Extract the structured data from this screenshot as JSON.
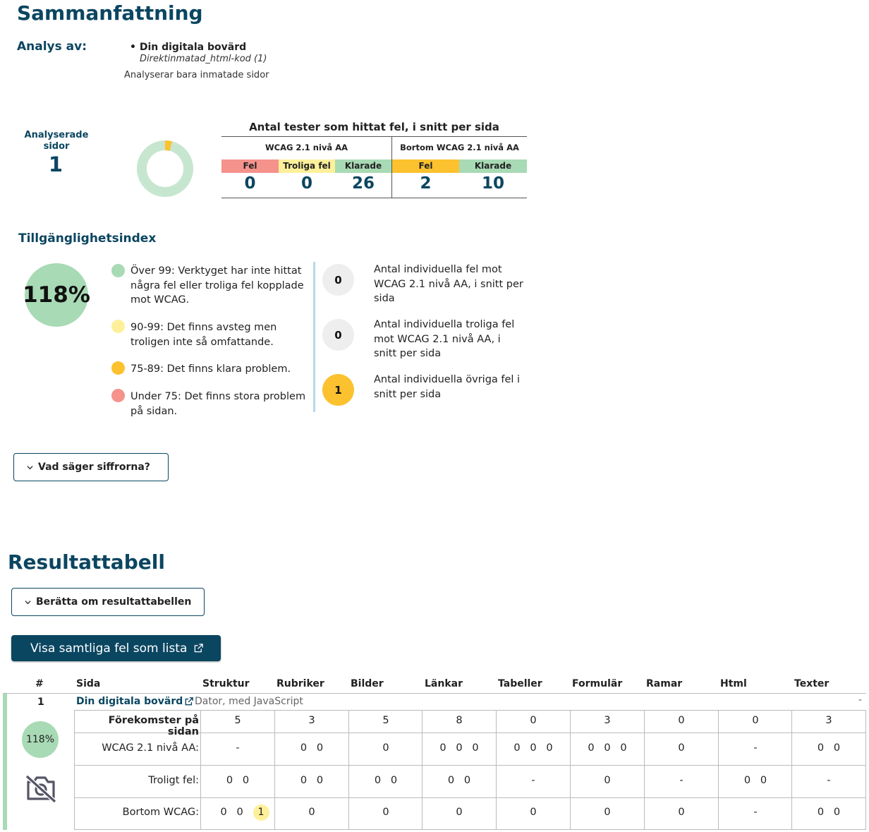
{
  "summary": {
    "title": "Sammanfattning",
    "analysis_label": "Analys av:",
    "site_name": "Din digitala bovärd",
    "site_source": "Direktinmatad_html-kod (1)",
    "scope_note": "Analyserar bara inmatade sidor",
    "analysed_pages_label_1": "Analyserade",
    "analysed_pages_label_2": "sidor",
    "analysed_pages_count": "1",
    "donut": {
      "passed_fraction": 0.96,
      "warn_fraction": 0.04,
      "passed_color": "#c7e6cf",
      "warn_color": "#fcc12e"
    }
  },
  "tests": {
    "title": "Antal tester som hittat fel, i snitt per sida",
    "wcag_group": "WCAG 2.1 nivå AA",
    "beyond_group": "Bortom WCAG 2.1 nivå AA",
    "wcag": {
      "fel_label": "Fel",
      "fel_value": "0",
      "troliga_label": "Troliga fel",
      "troliga_value": "0",
      "klarade_label": "Klarade",
      "klarade_value": "26"
    },
    "beyond": {
      "fel_label": "Fel",
      "fel_value": "2",
      "klarade_label": "Klarade",
      "klarade_value": "10"
    },
    "colors": {
      "fel": "#f5928c",
      "troliga": "#fdf09a",
      "klarade": "#a8dab5",
      "beyond_fel": "#fcc12e"
    }
  },
  "index": {
    "title": "Tillgänglighetsindex",
    "value": "118%",
    "legend": [
      {
        "text": "Över 99: Verktyget har inte hittat några fel eller troliga fel kopplade mot WCAG.",
        "color": "#a8dab5"
      },
      {
        "text": "90-99: Det finns avsteg men troligen inte så omfattande.",
        "color": "#fdf09a"
      },
      {
        "text": "75-89: Det finns klara problem.",
        "color": "#fcc12e"
      },
      {
        "text": "Under 75: Det finns stora problem på sidan.",
        "color": "#f5928c"
      }
    ],
    "counts": [
      {
        "value": "0",
        "text": "Antal individuella fel mot WCAG 2.1 nivå AA, i snitt per sida",
        "color": "#eeeeee"
      },
      {
        "value": "0",
        "text": "Antal individuella troliga fel mot WCAG 2.1 nivå AA, i snitt per sida",
        "color": "#eeeeee"
      },
      {
        "value": "1",
        "text": "Antal individuella övriga fel i snitt per sida",
        "color": "#fcc12e"
      }
    ],
    "expander_label": "Vad säger siffrorna?"
  },
  "results": {
    "title": "Resultattabell",
    "expander_label": "Berätta om resultattabellen",
    "show_all_label": "Visa samtliga fel som lista",
    "headers": [
      "#",
      "Sida",
      "Struktur",
      "Rubriker",
      "Bilder",
      "Länkar",
      "Tabeller",
      "Formulär",
      "Ramar",
      "Html",
      "Texter"
    ],
    "row": {
      "number": "1",
      "site": "Din digitala bovärd",
      "meta": "Dator, med JavaScript",
      "trailing": "-",
      "index": "118%",
      "lines": [
        {
          "label": "Förekomster på sidan",
          "bold": true,
          "cells": [
            "5",
            "3",
            "5",
            "8",
            "0",
            "3",
            "0",
            "0",
            "3"
          ]
        },
        {
          "label": "WCAG 2.1 nivå AA:",
          "bold": false,
          "cells": [
            "-",
            "0   0",
            "0",
            "0   0   0",
            "0   0   0",
            "0   0   0",
            "0",
            "-",
            "0   0"
          ]
        },
        {
          "label": "Troligt fel:",
          "bold": false,
          "cells": [
            "0   0",
            "0   0",
            "0   0",
            "0   0",
            "-",
            "0",
            "-",
            "0   0",
            "-"
          ]
        },
        {
          "label": "Bortom WCAG:",
          "bold": false,
          "cells": [
            "0   0",
            "0",
            "0",
            "0",
            "0",
            "0",
            "0",
            "-",
            "0   0"
          ],
          "chip": "1"
        }
      ]
    }
  }
}
